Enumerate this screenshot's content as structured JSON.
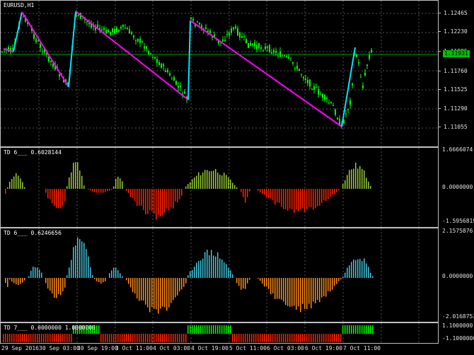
{
  "main": {
    "title": "EURUSD,H1",
    "current_price": "1.11931",
    "scale": [
      "1.12465",
      "1.12230",
      "1.11995",
      "1.11760",
      "1.11525",
      "1.11290",
      "1.11055"
    ]
  },
  "ind1": {
    "title": "TD 6___ 0.6028144",
    "scale": [
      "1.6666074",
      "0.0000000",
      "-1.5956819"
    ]
  },
  "ind2": {
    "title": "TD 6___ 0.6246656",
    "scale": [
      "2.1575876",
      "0.0000000",
      "-2.0168753"
    ]
  },
  "ind3": {
    "title": "TD 7___ 0.0000000 1.0000000",
    "scale": [
      "1.1000000",
      "-1.1000000"
    ]
  },
  "time_axis": [
    "29 Sep 2016",
    "30 Sep 03:00",
    "30 Sep 19:00",
    "3 Oct 11:00",
    "4 Oct 03:00",
    "4 Oct 19:00",
    "5 Oct 11:00",
    "6 Oct 03:00",
    "6 Oct 19:00",
    "7 Oct 11:00"
  ],
  "colors": {
    "candles": "#00ff00",
    "zigzag_up": "#00e5ff",
    "zigzag_down": "#ff00ff",
    "hist_pos": "#9acd32",
    "hist_neg": "#ff2200",
    "hist2_pos": "#40c8e0",
    "hist2_neg": "#ff8c1a",
    "level_line": "#00a000",
    "grid": "#555555"
  }
}
